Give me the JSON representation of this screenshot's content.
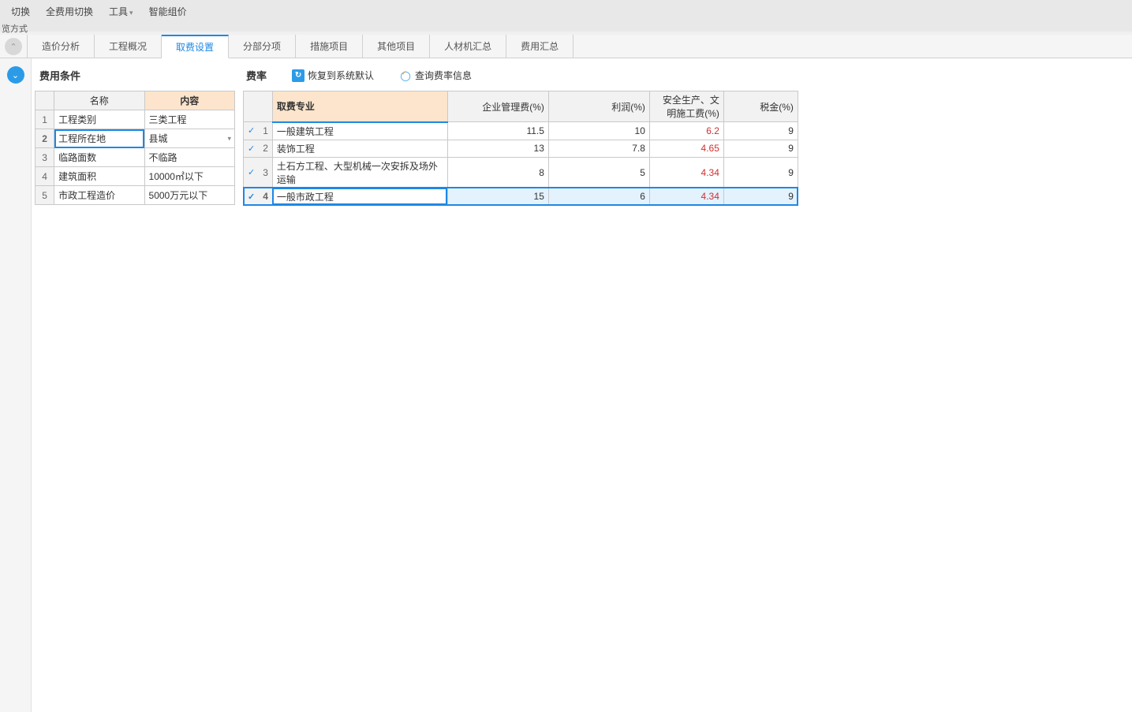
{
  "menu": {
    "switch": "切换",
    "full_cost_switch": "全费用切换",
    "tools": "工具",
    "smart_group": "智能组价",
    "calc_method": "览方式"
  },
  "tabs": {
    "cost_analysis": "造价分析",
    "project_overview": "工程概况",
    "fee_settings": "取费设置",
    "sub_items": "分部分项",
    "measure_items": "措施项目",
    "other_items": "其他项目",
    "labor_summary": "人材机汇总",
    "cost_summary": "费用汇总"
  },
  "left": {
    "title": "费用条件",
    "headers": {
      "name": "名称",
      "content": "内容"
    },
    "rows": [
      {
        "n": "1",
        "name": "工程类别",
        "val": "三类工程"
      },
      {
        "n": "2",
        "name": "工程所在地",
        "val": "县城"
      },
      {
        "n": "3",
        "name": "临路面数",
        "val": "不临路"
      },
      {
        "n": "4",
        "name": "建筑面积",
        "val": "10000㎡以下"
      },
      {
        "n": "5",
        "name": "市政工程造价",
        "val": "5000万元以下"
      }
    ]
  },
  "right": {
    "title": "费率",
    "restore": "恢复到系统默认",
    "query": "查询费率信息",
    "headers": {
      "specialty": "取费专业",
      "mgmt": "企业管理费(%)",
      "profit": "利润(%)",
      "safety": "安全生产、文明施工费(%)",
      "tax": "税金(%)"
    },
    "rows": [
      {
        "n": "1",
        "name": "一般建筑工程",
        "mgmt": "11.5",
        "profit": "10",
        "safety": "6.2",
        "tax": "9"
      },
      {
        "n": "2",
        "name": "装饰工程",
        "mgmt": "13",
        "profit": "7.8",
        "safety": "4.65",
        "tax": "9"
      },
      {
        "n": "3",
        "name": "土石方工程、大型机械一次安拆及场外运输",
        "mgmt": "8",
        "profit": "5",
        "safety": "4.34",
        "tax": "9"
      },
      {
        "n": "4",
        "name": "一般市政工程",
        "mgmt": "15",
        "profit": "6",
        "safety": "4.34",
        "tax": "9"
      }
    ]
  }
}
